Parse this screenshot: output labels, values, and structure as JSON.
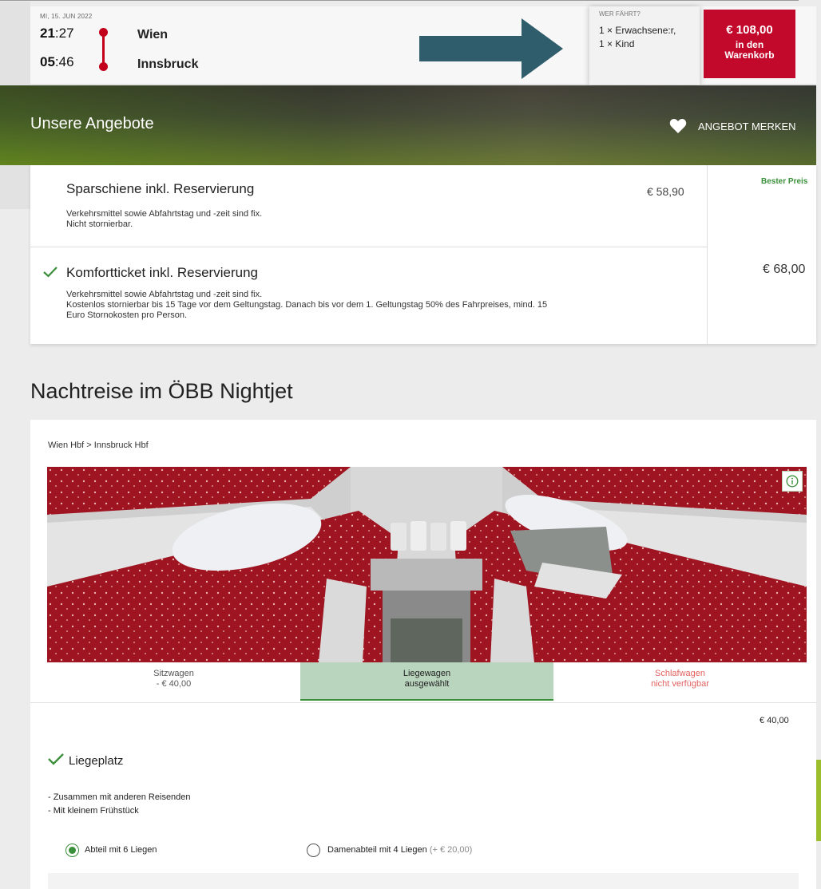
{
  "trip": {
    "date": "MI, 15. JUN 2022",
    "departure_hour": "21",
    "departure_min": ":27",
    "arrival_hour": "05",
    "arrival_min": ":46",
    "origin": "Wien",
    "destination": "Innsbruck"
  },
  "passengers": {
    "label": "WER FÄHRT?",
    "line1": "1 × Erwachsene:r,",
    "line2": "1 × Kind"
  },
  "cart": {
    "price": "€ 108,00",
    "label_line1": "in den",
    "label_line2": "Warenkorb"
  },
  "offers": {
    "title": "Unsere Angebote",
    "merken_label": "ANGEBOT MERKEN",
    "items": [
      {
        "title": "Sparschiene inkl. Reservierung",
        "desc_line1": "Verkehrsmittel sowie Abfahrtstag und -zeit sind fix.",
        "desc_line2": "Nicht stornierbar.",
        "price": "€ 58,90",
        "badge": "Bester Preis"
      },
      {
        "title": "Komfortticket inkl. Reservierung",
        "desc_line1": "Verkehrsmittel sowie Abfahrtstag und -zeit sind fix.",
        "desc_line2": "Kostenlos stornierbar bis 15 Tage vor dem Geltungstag. Danach bis vor dem 1. Geltungstag 50% des Fahrpreises, mind. 15",
        "desc_line3": "Euro Stornokosten pro Person.",
        "price": "€ 68,00"
      }
    ]
  },
  "nightjet": {
    "title": "Nachtreise im ÖBB Nightjet",
    "route": "Wien Hbf > Innsbruck Hbf",
    "tabs": [
      {
        "label": "Sitzwagen",
        "sub": "- € 40,00"
      },
      {
        "label": "Liegewagen",
        "sub": "ausgewählt"
      },
      {
        "label": "Schlafwagen",
        "sub": "nicht verfügbar"
      }
    ],
    "price": "€ 40,00",
    "berth_label": "Liegeplatz",
    "features": [
      "- Zusammen mit anderen Reisenden",
      "- Mit kleinem Frühstück"
    ],
    "options": [
      {
        "label": "Abteil mit 6 Liegen",
        "extra": ""
      },
      {
        "label": "Damenabteil mit 4 Liegen",
        "extra": "(+ € 20,00)"
      }
    ]
  },
  "colors": {
    "brand_red": "#c3092b",
    "accent_green": "#3a8f3a",
    "selected_tab": "#bad5be",
    "unavailable": "#e26161",
    "arrow": "#2f5d6c"
  },
  "icons": [
    "heart-icon",
    "checkmark-icon",
    "info-icon",
    "arrow-right-icon"
  ]
}
